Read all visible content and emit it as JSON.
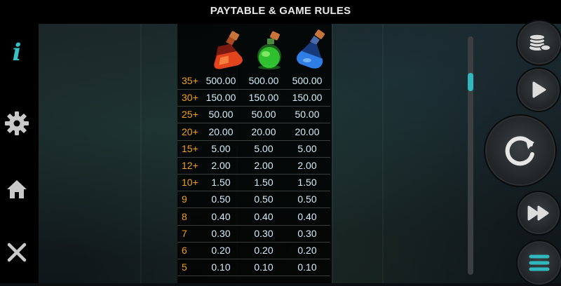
{
  "header": {
    "title": "PAYTABLE & GAME RULES"
  },
  "sidebar": {
    "icons": [
      "info-icon",
      "gear-icon",
      "home-icon",
      "close-icon"
    ],
    "info_label": "i"
  },
  "paytable": {
    "symbols": [
      "red-potion",
      "green-potion",
      "blue-potion"
    ],
    "rows": [
      {
        "count": "35+",
        "values": [
          "500.00",
          "500.00",
          "500.00"
        ]
      },
      {
        "count": "30+",
        "values": [
          "150.00",
          "150.00",
          "150.00"
        ]
      },
      {
        "count": "25+",
        "values": [
          "50.00",
          "50.00",
          "50.00"
        ]
      },
      {
        "count": "20+",
        "values": [
          "20.00",
          "20.00",
          "20.00"
        ]
      },
      {
        "count": "15+",
        "values": [
          "5.00",
          "5.00",
          "5.00"
        ]
      },
      {
        "count": "12+",
        "values": [
          "2.00",
          "2.00",
          "2.00"
        ]
      },
      {
        "count": "10+",
        "values": [
          "1.50",
          "1.50",
          "1.50"
        ]
      },
      {
        "count": "9",
        "values": [
          "0.50",
          "0.50",
          "0.50"
        ]
      },
      {
        "count": "8",
        "values": [
          "0.40",
          "0.40",
          "0.40"
        ]
      },
      {
        "count": "7",
        "values": [
          "0.30",
          "0.30",
          "0.30"
        ]
      },
      {
        "count": "6",
        "values": [
          "0.20",
          "0.20",
          "0.20"
        ]
      },
      {
        "count": "5",
        "values": [
          "0.10",
          "0.10",
          "0.10"
        ]
      }
    ]
  },
  "controls": {
    "buttons": [
      "coins-icon",
      "play-icon",
      "spin-icon",
      "fast-forward-icon",
      "menu-icon"
    ]
  },
  "colors": {
    "accent": "#2fb8bd",
    "count_color": "#f0a020",
    "value_color": "#d4ecf8"
  }
}
